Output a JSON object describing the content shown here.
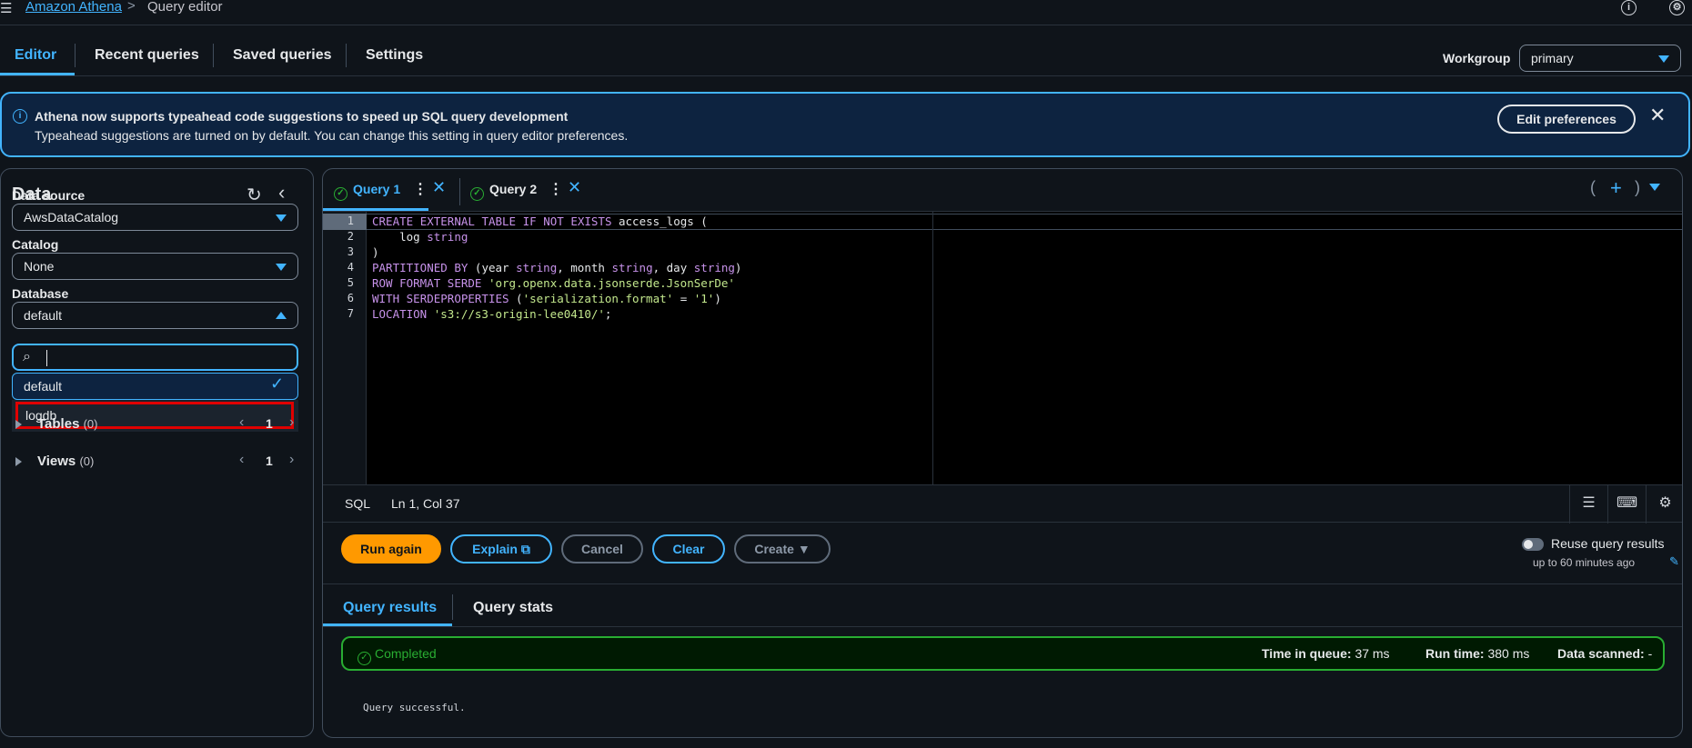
{
  "breadcrumb": {
    "root": "Amazon Athena",
    "separator": ">",
    "current": "Query editor"
  },
  "tabs": [
    "Editor",
    "Recent queries",
    "Saved queries",
    "Settings"
  ],
  "workgroup": {
    "label": "Workgroup",
    "value": "primary"
  },
  "banner": {
    "title": "Athena now supports typeahead code suggestions to speed up SQL query development",
    "text": "Typeahead suggestions are turned on by default. You can change this setting in query editor preferences.",
    "button": "Edit preferences"
  },
  "data_panel": {
    "title": "Data",
    "data_source_label": "Data source",
    "data_source_value": "AwsDataCatalog",
    "catalog_label": "Catalog",
    "catalog_value": "None",
    "database_label": "Database",
    "database_value": "default",
    "search_value": "",
    "options": [
      "default",
      "logdb"
    ],
    "tables": {
      "label": "Tables",
      "count": "(0)",
      "page": "1"
    },
    "views": {
      "label": "Views",
      "count": "(0)",
      "page": "1"
    }
  },
  "query_tabs": [
    "Query 1",
    "Query 2"
  ],
  "tab_add": "( + )",
  "code_lines": [
    "CREATE EXTERNAL TABLE IF NOT EXISTS access_logs (",
    "    log string",
    ")",
    "PARTITIONED BY (year string, month string, day string)",
    "ROW FORMAT SERDE 'org.openx.data.jsonserde.JsonSerDe'",
    "WITH SERDEPROPERTIES ('serialization.format' = '1')",
    "LOCATION 's3://s3-origin-lee0410/';"
  ],
  "line_numbers": [
    "1",
    "2",
    "3",
    "4",
    "5",
    "6",
    "7"
  ],
  "status_bar": {
    "language": "SQL",
    "cursor": "Ln 1, Col 37"
  },
  "actions": {
    "run": "Run again",
    "explain": "Explain",
    "cancel": "Cancel",
    "clear": "Clear",
    "create": "Create",
    "reuse_label": "Reuse query results",
    "reuse_sub": "up to 60 minutes ago"
  },
  "results": {
    "tab_results": "Query results",
    "tab_stats": "Query stats",
    "status": "Completed",
    "time_in_queue_label": "Time in queue:",
    "time_in_queue": "37 ms",
    "run_time_label": "Run time:",
    "run_time": "380 ms",
    "data_scanned_label": "Data scanned:",
    "data_scanned": "-",
    "message": "Query successful."
  },
  "colors": {
    "accent": "#42b4ff",
    "run_button": "#ff9900",
    "success": "#29ad32",
    "highlight_box": "#e00000"
  }
}
